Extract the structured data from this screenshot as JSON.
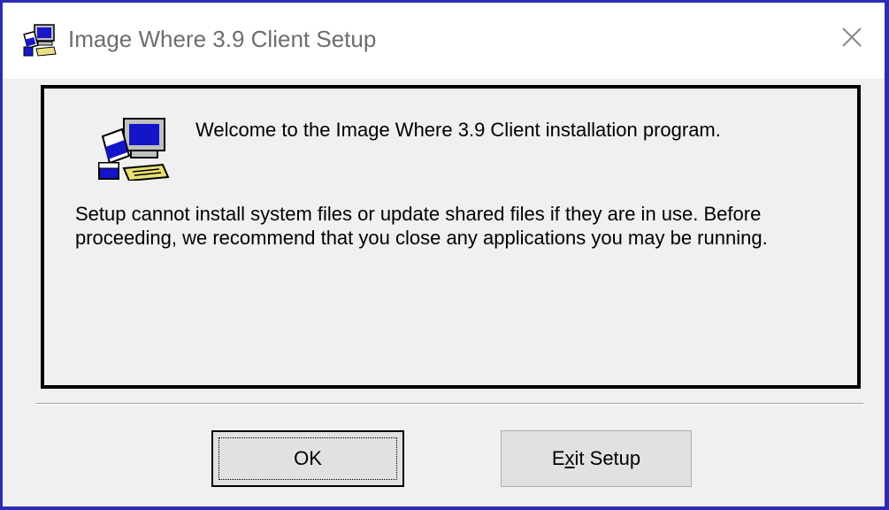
{
  "window": {
    "title": "Image Where 3.9 Client Setup",
    "icon": "setup-computer-icon",
    "close_icon": "close-icon"
  },
  "content": {
    "welcome": "Welcome to the Image Where 3.9 Client installation program.",
    "message": "Setup cannot install system files or update shared files if they are in use. Before proceeding, we recommend that you close any applications you may be running.",
    "icon": "setup-computer-icon"
  },
  "buttons": {
    "ok_label": "OK",
    "exit_label_pre": "E",
    "exit_label_mnemonic": "x",
    "exit_label_post": "it Setup"
  },
  "colors": {
    "border": "#2b2bb8",
    "dialog_bg": "#f0f0f0",
    "button_bg": "#e1e1e1"
  }
}
